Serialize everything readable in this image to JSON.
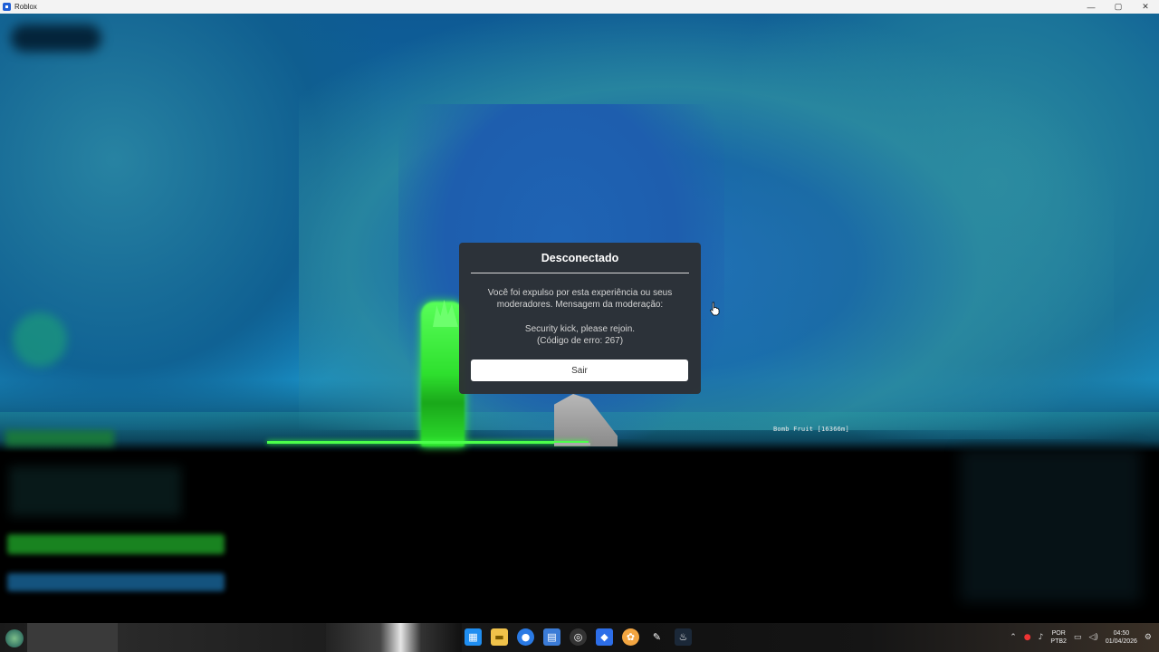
{
  "window": {
    "title": "Roblox",
    "controls": [
      "—",
      "▢",
      "✕"
    ]
  },
  "game": {
    "overhead_label": "Bomb Fruit [16366m]"
  },
  "dialog": {
    "title": "Desconectado",
    "message": "Você foi expulso por esta experiência ou seus moderadores. Mensagem da moderação:",
    "detail_line1": "Security kick, please rejoin.",
    "detail_line2": "(Código de erro: 267)",
    "button_label": "Sair"
  },
  "taskbar": {
    "pinned_icons": [
      "windows-start-icon",
      "file-explorer-icon",
      "chrome-icon",
      "store-icon",
      "obs-icon",
      "roblox-icon",
      "paint-icon",
      "pen-icon",
      "steam-icon"
    ],
    "tray": {
      "language_top": "POR",
      "language_bottom": "PTB2",
      "time": "04:50",
      "date": "01/04/2026"
    }
  },
  "colors": {
    "dialog_bg": "#2d3034",
    "accent_green": "#3bff3b"
  }
}
